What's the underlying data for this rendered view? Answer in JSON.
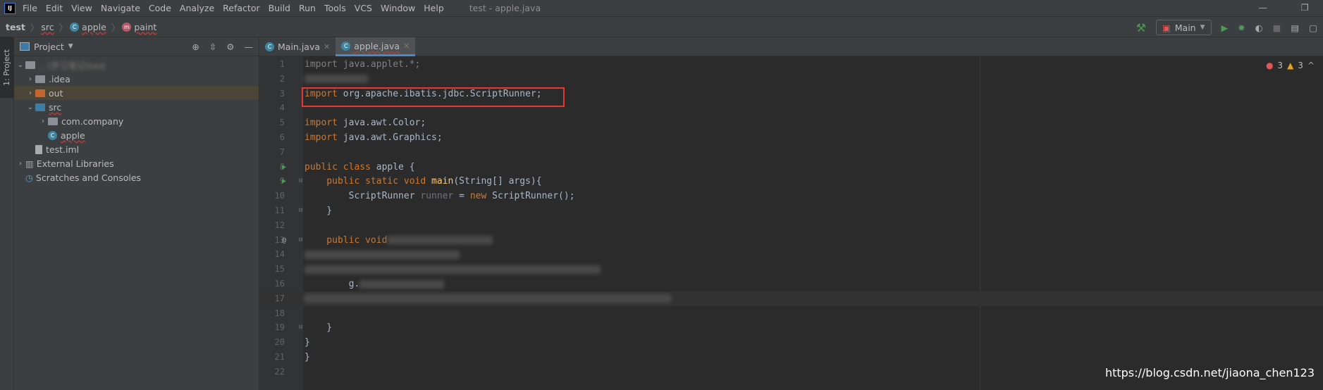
{
  "menubar": {
    "logo": "IJ",
    "items": [
      "File",
      "Edit",
      "View",
      "Navigate",
      "Code",
      "Analyze",
      "Refactor",
      "Build",
      "Run",
      "Tools",
      "VCS",
      "Window",
      "Help"
    ],
    "window_title": "test - apple.java"
  },
  "breadcrumb": [
    "test",
    "src",
    "apple",
    "paint"
  ],
  "toolbar": {
    "run_config": "Main"
  },
  "stripe": {
    "project_tab": "1: Project"
  },
  "project": {
    "title": "Project",
    "tree": [
      {
        "label": "…\\学习笔记\\test",
        "blurred": true
      },
      {
        "label": ".idea"
      },
      {
        "label": "out"
      },
      {
        "label": "src"
      },
      {
        "label": "com.company"
      },
      {
        "label": "apple"
      },
      {
        "label": "test.iml"
      },
      {
        "label": "External Libraries"
      },
      {
        "label": "Scratches and Consoles"
      }
    ]
  },
  "tabs": [
    {
      "label": "Main.java"
    },
    {
      "label": "apple.java",
      "active": true
    }
  ],
  "inspections": {
    "errors": "3",
    "warnings": "3"
  },
  "code": {
    "l1": "import java.applet.*;",
    "l3a": "import",
    "l3b": " org.apache.ibatis.jdbc.ScriptRunner;",
    "l5a": "import",
    "l5b": " java.awt.Color;",
    "l6a": "import",
    "l6b": " java.awt.Graphics;",
    "l8a": "public class",
    "l8b": " apple {",
    "l9a": "    public static void ",
    "l9b": "main",
    "l9c": "(String[] args){",
    "l10a": "        ScriptRunner ",
    "l10b": "runner",
    "l10c": " = ",
    "l10d": "new",
    "l10e": " ScriptRunner();",
    "l11": "    }",
    "l13": "    public void",
    "l16": "        g.",
    "l19": "    }",
    "l20": "}",
    "l21": "}",
    "annotation": "@"
  },
  "watermark": "https://blog.csdn.net/jiaona_chen123"
}
